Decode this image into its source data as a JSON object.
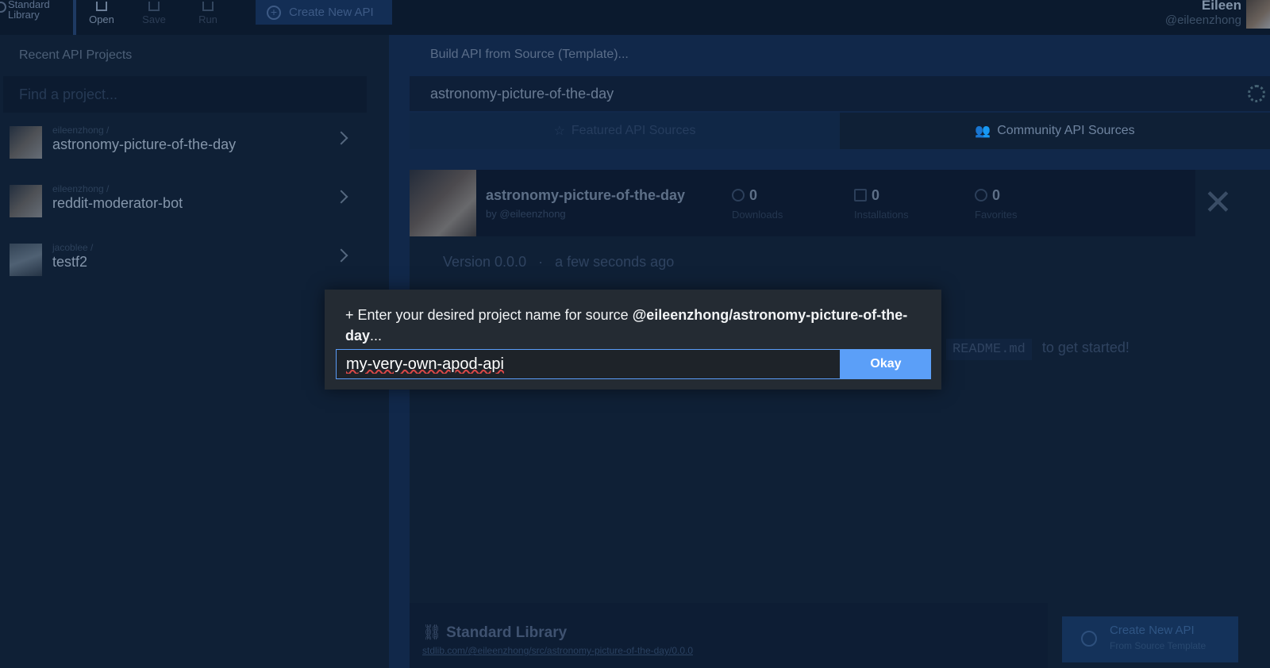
{
  "topbar": {
    "brand_line1": "Standard",
    "brand_line2": "Library",
    "nav": [
      {
        "label": "Open"
      },
      {
        "label": "Save"
      },
      {
        "label": "Run"
      }
    ],
    "create_api_label": "Create New API",
    "user_name": "Eileen",
    "user_handle": "@eileenzhong"
  },
  "sidebar": {
    "title": "Recent API Projects",
    "search_placeholder": "Find a project...",
    "projects": [
      {
        "owner": "eileenzhong /",
        "name": "astronomy-picture-of-the-day"
      },
      {
        "owner": "eileenzhong /",
        "name": "reddit-moderator-bot"
      },
      {
        "owner": "jacoblee /",
        "name": "testf2"
      }
    ]
  },
  "main": {
    "title": "Build API from Source (Template)...",
    "search_value": "astronomy-picture-of-the-day",
    "tabs": [
      {
        "label": "Featured API Sources",
        "icon": "star-icon"
      },
      {
        "label": "Community API Sources",
        "icon": "users-icon"
      }
    ],
    "card": {
      "title": "astronomy-picture-of-the-day",
      "by": "by @eileenzhong",
      "stats": [
        {
          "value": "0",
          "label": "Downloads",
          "icon": "download-icon"
        },
        {
          "value": "0",
          "label": "Installations",
          "icon": "copy-icon"
        },
        {
          "value": "0",
          "label": "Favorites",
          "icon": "heart-icon"
        }
      ],
      "version": "Version 0.0.0",
      "version_sep": "·",
      "version_time": "a few seconds ago",
      "readme_code": "README.md",
      "readme_tail": "to get started!"
    },
    "footer": {
      "title": "Standard Library",
      "link": "stdlib.com/@eileenzhong/src/astronomy-picture-of-the-day/0.0.0"
    },
    "create_button": {
      "line1": "Create New API",
      "line2": "From Source Template"
    }
  },
  "modal": {
    "prompt_prefix": "Enter your desired project name for source ",
    "prompt_source": "@eileenzhong/astronomy-picture-of-the-day",
    "prompt_suffix": "...",
    "input_value": "my-very-own-apod-api",
    "okay_label": "Okay"
  }
}
